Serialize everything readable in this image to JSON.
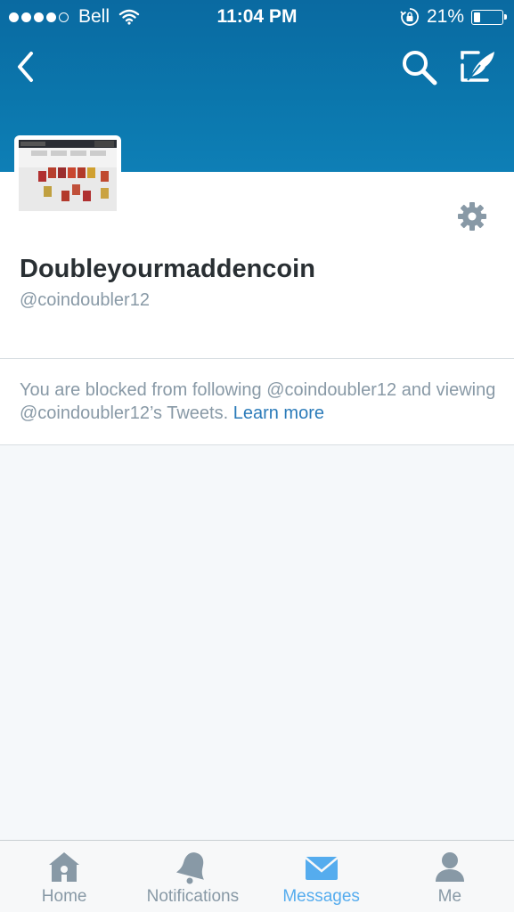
{
  "status_bar": {
    "carrier": "Bell",
    "time": "11:04 PM",
    "battery_percent_label": "21%",
    "battery_level": 0.21,
    "signal_bars_filled": 4,
    "signal_bars_total": 5
  },
  "header": {
    "back_icon": "chevron-left-icon",
    "search_icon": "search-icon",
    "compose_icon": "compose-tweet-icon"
  },
  "profile": {
    "name": "Doubleyourmaddencoin",
    "handle": "@coindoubler12",
    "settings_icon": "gear-icon"
  },
  "blocked_notice": {
    "text": "You are blocked from following @coindoubler12 and viewing @coindoubler12’s Tweets.",
    "link_label": "Learn more"
  },
  "tabs": [
    {
      "label": "Home",
      "icon": "home-icon",
      "active": false
    },
    {
      "label": "Notifications",
      "icon": "bell-icon",
      "active": false
    },
    {
      "label": "Messages",
      "icon": "envelope-icon",
      "active": true
    },
    {
      "label": "Me",
      "icon": "person-icon",
      "active": false
    }
  ],
  "colors": {
    "banner": "#0b77ad",
    "accent": "#55acee",
    "link": "#2b7bb9",
    "muted": "#8899a6"
  }
}
